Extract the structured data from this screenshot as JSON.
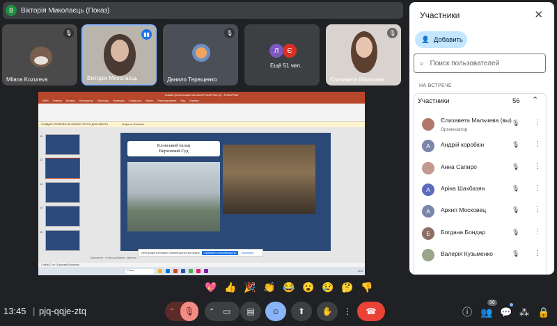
{
  "presenter": {
    "avatar_letter": "В",
    "title": "Вікторія Миколаєць (Показ)"
  },
  "tiles": [
    {
      "name": "Milana Kozureva"
    },
    {
      "name": "Вікторія Миколаєць"
    },
    {
      "name": "Данило Терещенко"
    },
    {
      "name": "Ещё 51 чел.",
      "letter_a": "Л",
      "letter_b": "Є"
    },
    {
      "name": "Єлизавета Мальчева"
    }
  ],
  "shared": {
    "window_title": "Новая Презентация Microsoft PowerPoint (2) - PowerPoint",
    "tabs": [
      "Файл",
      "Главная",
      "Вставка",
      "Конструктор",
      "Переходы",
      "Анимация",
      "Слайд-шоу",
      "Запись",
      "Рецензирование",
      "Вид",
      "Справка"
    ],
    "warning_text": "СОЗДАТЬ РЕЗЕРВНУЮ КОПИЮ ЭТОГО ДОКУМЕНТА",
    "warning_button": "Открыть OneDrive",
    "thumb_numbers": [
      "11",
      "12",
      "13",
      "14",
      "15"
    ],
    "slide_title_line1": "Кловський палац",
    "slide_title_line2": "Верховний Суд",
    "share_text": "meet.google.com ведет спільний доступ до екрана",
    "share_stop": "Припинити спільний доступ",
    "share_hide": "Приховати",
    "notes": "Щелкните, чтобы добавить заметки",
    "status": "Слайд 12 из 18   русский (Украина)",
    "taskbar_search": "Поиск",
    "taskbar_time": "13:45"
  },
  "reactions": [
    "💖",
    "👍",
    "🎉",
    "👏",
    "😂",
    "😮",
    "😢",
    "🤔",
    "👎"
  ],
  "bottom": {
    "time": "13:45",
    "sep": "|",
    "code": "pjq-qqje-ztq",
    "people_count": "56"
  },
  "panel": {
    "title": "Участники",
    "add_label": "Добавить",
    "search_placeholder": "Поиск пользователей",
    "section": "НА ВСТРЕЧЕ",
    "group": "Участники",
    "group_count": "56",
    "people": [
      {
        "name": "Єлизавета Мальчева (вы)",
        "role": "Организатор",
        "letter": "",
        "color": "#b0786a"
      },
      {
        "name": "Андрій коробкін",
        "role": "",
        "letter": "А",
        "color": "#7b86a8"
      },
      {
        "name": "Анна Сапиро",
        "role": "",
        "letter": "",
        "color": "#c29a8f"
      },
      {
        "name": "Аріна Шахбазян",
        "role": "",
        "letter": "А",
        "color": "#5c6bc0"
      },
      {
        "name": "Архип Московец",
        "role": "",
        "letter": "А",
        "color": "#7b86a8"
      },
      {
        "name": "Богдана Бондар",
        "role": "",
        "letter": "Б",
        "color": "#8d6e63"
      },
      {
        "name": "Валерія Кузьменко",
        "role": "",
        "letter": "",
        "color": "#9aa58a"
      }
    ]
  },
  "colors": {
    "accent": "#8ab4f8",
    "end_call": "#ea4335",
    "mute": "#f28b82",
    "add_button": "#c2e7ff"
  }
}
